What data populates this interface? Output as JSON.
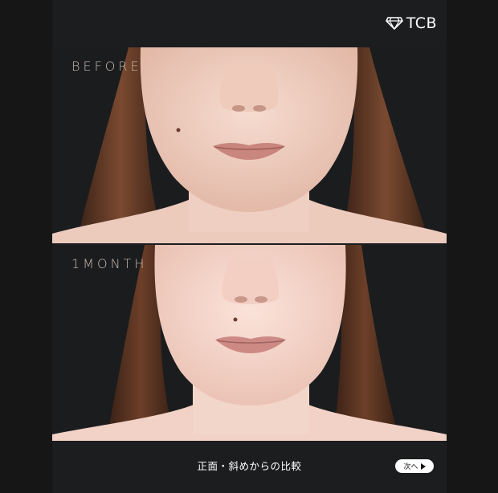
{
  "brand": {
    "logo_text": "TCB",
    "logo_icon": "diamond-icon"
  },
  "photos": [
    {
      "label": "BEFORE"
    },
    {
      "label": "1MONTH"
    }
  ],
  "caption": "正面・斜めからの比較",
  "next_button": {
    "label": "次へ",
    "icon": "play-arrow-icon"
  },
  "colors": {
    "background": "#1c1d1f",
    "label": "#c7b9ad",
    "skin": "#f1d2c5",
    "hair": "#5a3322"
  }
}
